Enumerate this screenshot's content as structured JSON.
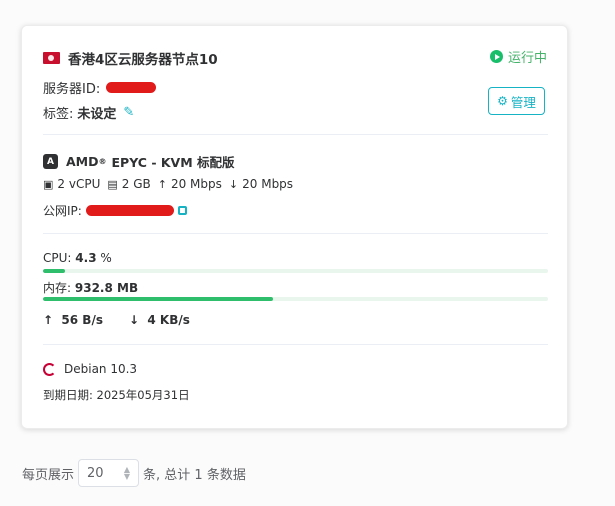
{
  "server": {
    "name": "香港4区云服务器节点10",
    "status": "运行中",
    "id_label": "服务器ID:",
    "tag_label": "标签:",
    "tag_value": "未设定",
    "manage_label": "管理"
  },
  "cpu_info": {
    "brand": "AMD",
    "reg": "®",
    "model": "EPYC - KVM 标配版",
    "icon_letter": "A"
  },
  "specs": {
    "vcpu": "2 vCPU",
    "memory": "2 GB",
    "upload": "20 Mbps",
    "download": "20 Mbps"
  },
  "ip": {
    "label": "公网IP:"
  },
  "usage": {
    "cpu_label": "CPU:",
    "cpu_value": "4.3",
    "cpu_unit": "%",
    "cpu_fraction": 0.043,
    "mem_label": "内存:",
    "mem_value": "932.8 MB",
    "mem_fraction": 0.455
  },
  "network": {
    "up": "56 B/s",
    "down": "4 KB/s"
  },
  "os": {
    "name": "Debian 10.3",
    "expire_label": "到期日期:",
    "expire_date": "2025年05月31日"
  },
  "pagination": {
    "prefix": "每页展示",
    "page_size": "20",
    "suffix": "条, 总计 1 条数据"
  },
  "colors": {
    "accent": "#16b3c4",
    "running": "#19be6b",
    "bar": "#2fbf6c"
  }
}
